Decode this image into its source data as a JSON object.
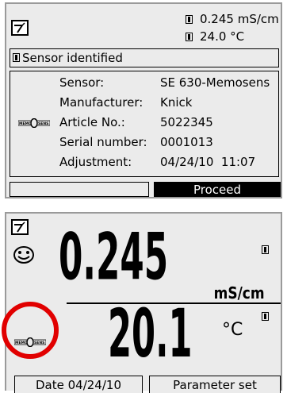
{
  "screen1": {
    "mode_icon": "meter-mode-icon",
    "status_readout": {
      "conductivity": "0.245 mS/cm",
      "temperature": "24.0 °C"
    },
    "message": "Sensor identified",
    "logo_text": "MEMO SENS",
    "sensor_info": [
      {
        "label": "Sensor:",
        "value": "SE 630-Memosens"
      },
      {
        "label": "Manufacturer:",
        "value": "Knick"
      },
      {
        "label": "Article No.:",
        "value": "5022345"
      },
      {
        "label": "Serial number:",
        "value": "0001013"
      },
      {
        "label": "Adjustment:",
        "value": "04/24/10  11:07"
      }
    ],
    "softkey_left": "",
    "softkey_right": "Proceed"
  },
  "screen2": {
    "mode_icon": "meter-mode-icon",
    "status_icon": "smiley-icon",
    "primary_value": "0.245",
    "primary_unit": "mS/cm",
    "secondary_value": "20.1",
    "secondary_unit": "°C",
    "logo_text": "MEMO SENS",
    "softkey_left": "Date 04/24/10",
    "softkey_right": "Parameter set"
  },
  "colors": {
    "highlight_circle": "#e10000",
    "screen_bg": "#ebebeb",
    "frame": "#9a9a9a"
  }
}
